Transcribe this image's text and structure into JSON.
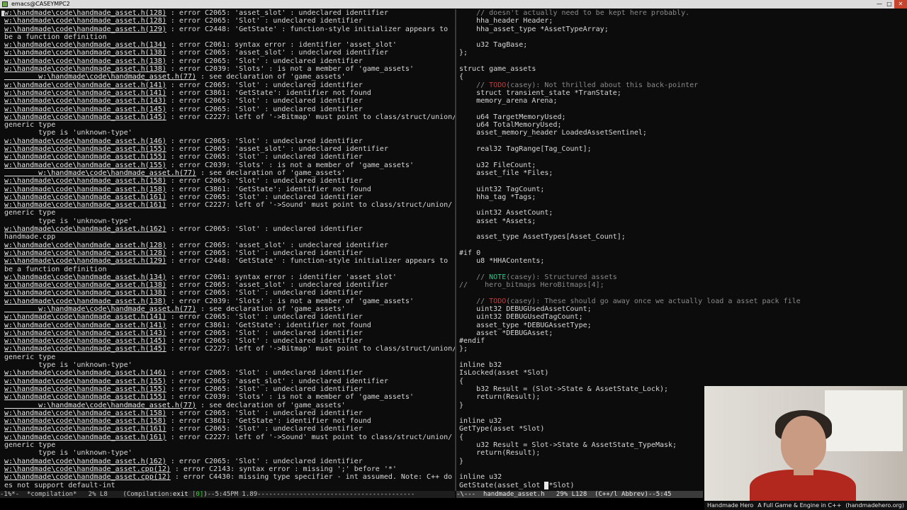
{
  "window": {
    "title": "emacs@CASEYMPC2",
    "min": "—",
    "max": "□",
    "close": "✕"
  },
  "compilation_lines": [
    "w:\\handmade\\code\\handmade_asset.h(128) : error C2065: 'asset_slot' : undeclared identifier",
    "w:\\handmade\\code\\handmade_asset.h(128) : error C2065: 'Slot' : undeclared identifier",
    "w:\\handmade\\code\\handmade_asset.h(129) : error C2448: 'GetState' : function-style initializer appears to",
    "be a function definition",
    "w:\\handmade\\code\\handmade_asset.h(134) : error C2061: syntax error : identifier 'asset_slot'",
    "w:\\handmade\\code\\handmade_asset.h(138) : error C2065: 'asset_slot' : undeclared identifier",
    "w:\\handmade\\code\\handmade_asset.h(138) : error C2065: 'Slot' : undeclared identifier",
    "w:\\handmade\\code\\handmade_asset.h(138) : error C2039: 'Slots' : is not a member of 'game_assets'",
    "        w:\\handmade\\code\\handmade_asset.h(77) : see declaration of 'game_assets'",
    "w:\\handmade\\code\\handmade_asset.h(141) : error C2065: 'Slot' : undeclared identifier",
    "w:\\handmade\\code\\handmade_asset.h(141) : error C3861: 'GetState': identifier not found",
    "w:\\handmade\\code\\handmade_asset.h(143) : error C2065: 'Slot' : undeclared identifier",
    "w:\\handmade\\code\\handmade_asset.h(145) : error C2065: 'Slot' : undeclared identifier",
    "w:\\handmade\\code\\handmade_asset.h(145) : error C2227: left of '->Bitmap' must point to class/struct/union/",
    "generic type",
    "        type is 'unknown-type'",
    "w:\\handmade\\code\\handmade_asset.h(146) : error C2065: 'Slot' : undeclared identifier",
    "w:\\handmade\\code\\handmade_asset.h(155) : error C2065: 'asset_slot' : undeclared identifier",
    "w:\\handmade\\code\\handmade_asset.h(155) : error C2065: 'Slot' : undeclared identifier",
    "w:\\handmade\\code\\handmade_asset.h(155) : error C2039: 'Slots' : is not a member of 'game_assets'",
    "        w:\\handmade\\code\\handmade_asset.h(77) : see declaration of 'game_assets'",
    "w:\\handmade\\code\\handmade_asset.h(158) : error C2065: 'Slot' : undeclared identifier",
    "w:\\handmade\\code\\handmade_asset.h(158) : error C3861: 'GetState': identifier not found",
    "w:\\handmade\\code\\handmade_asset.h(161) : error C2065: 'Slot' : undeclared identifier",
    "w:\\handmade\\code\\handmade_asset.h(161) : error C2227: left of '->Sound' must point to class/struct/union/",
    "generic type",
    "        type is 'unknown-type'",
    "w:\\handmade\\code\\handmade_asset.h(162) : error C2065: 'Slot' : undeclared identifier",
    "handmade.cpp",
    "w:\\handmade\\code\\handmade_asset.h(128) : error C2065: 'asset_slot' : undeclared identifier",
    "w:\\handmade\\code\\handmade_asset.h(128) : error C2065: 'Slot' : undeclared identifier",
    "w:\\handmade\\code\\handmade_asset.h(129) : error C2448: 'GetState' : function-style initializer appears to",
    "be a function definition",
    "w:\\handmade\\code\\handmade_asset.h(134) : error C2061: syntax error : identifier 'asset_slot'",
    "w:\\handmade\\code\\handmade_asset.h(138) : error C2065: 'asset_slot' : undeclared identifier",
    "w:\\handmade\\code\\handmade_asset.h(138) : error C2065: 'Slot' : undeclared identifier",
    "w:\\handmade\\code\\handmade_asset.h(138) : error C2039: 'Slots' : is not a member of 'game_assets'",
    "        w:\\handmade\\code\\handmade_asset.h(77) : see declaration of 'game_assets'",
    "w:\\handmade\\code\\handmade_asset.h(141) : error C2065: 'Slot' : undeclared identifier",
    "w:\\handmade\\code\\handmade_asset.h(141) : error C3861: 'GetState': identifier not found",
    "w:\\handmade\\code\\handmade_asset.h(143) : error C2065: 'Slot' : undeclared identifier",
    "w:\\handmade\\code\\handmade_asset.h(145) : error C2065: 'Slot' : undeclared identifier",
    "w:\\handmade\\code\\handmade_asset.h(145) : error C2227: left of '->Bitmap' must point to class/struct/union/",
    "generic type",
    "        type is 'unknown-type'",
    "w:\\handmade\\code\\handmade_asset.h(146) : error C2065: 'Slot' : undeclared identifier",
    "w:\\handmade\\code\\handmade_asset.h(155) : error C2065: 'asset_slot' : undeclared identifier",
    "w:\\handmade\\code\\handmade_asset.h(155) : error C2065: 'Slot' : undeclared identifier",
    "w:\\handmade\\code\\handmade_asset.h(155) : error C2039: 'Slots' : is not a member of 'game_assets'",
    "        w:\\handmade\\code\\handmade_asset.h(77) : see declaration of 'game_assets'",
    "w:\\handmade\\code\\handmade_asset.h(158) : error C2065: 'Slot' : undeclared identifier",
    "w:\\handmade\\code\\handmade_asset.h(158) : error C3861: 'GetState': identifier not found",
    "w:\\handmade\\code\\handmade_asset.h(161) : error C2065: 'Slot' : undeclared identifier",
    "w:\\handmade\\code\\handmade_asset.h(161) : error C2227: left of '->Sound' must point to class/struct/union/",
    "generic type",
    "        type is 'unknown-type'",
    "w:\\handmade\\code\\handmade_asset.h(162) : error C2065: 'Slot' : undeclared identifier",
    "w:\\handmade\\code\\handmade_asset.cpp(12) : error C2143: syntax error : missing ';' before '*'",
    "w:\\handmade\\code\\handmade_asset.cpp(12) : error C4430: missing type specifier - int assumed. Note: C++ do",
    "es not support default-int"
  ],
  "code_lines": [
    "    // doesn't actually need to be kept here probably.",
    "    hha_header Header;",
    "    hha_asset_type *AssetTypeArray;",
    "",
    "    u32 TagBase;",
    "};",
    "",
    "struct game_assets",
    "{",
    "    // TODO(casey): Not thrilled about this back-pointer",
    "    struct transient_state *TranState;",
    "    memory_arena Arena;",
    "",
    "    u64 TargetMemoryUsed;",
    "    u64 TotalMemoryUsed;",
    "    asset_memory_header LoadedAssetSentinel;",
    "",
    "    real32 TagRange[Tag_Count];",
    "",
    "    u32 FileCount;",
    "    asset_file *Files;",
    "",
    "    uint32 TagCount;",
    "    hha_tag *Tags;",
    "",
    "    uint32 AssetCount;",
    "    asset *Assets;",
    "",
    "    asset_type AssetTypes[Asset_Count];",
    "",
    "#if 0",
    "    u8 *HHAContents;",
    "",
    "    // NOTE(casey): Structured assets",
    "//    hero_bitmaps HeroBitmaps[4];",
    "",
    "    // TODO(casey): These should go away once we actually load a asset pack file",
    "    uint32 DEBUGUsedAssetCount;",
    "    uint32 DEBUGUsedTagCount;",
    "    asset_type *DEBUGAssetType;",
    "    asset *DEBUGAsset;",
    "#endif",
    "};",
    "",
    "inline b32",
    "IsLocked(asset *Slot)",
    "{",
    "    b32 Result = (Slot->State & AssetState_Lock);",
    "    return(Result);",
    "}",
    "",
    "inline u32",
    "GetType(asset *Slot)",
    "{",
    "    u32 Result = Slot->State & AssetState_TypeMask;",
    "    return(Result);",
    "}",
    "",
    "inline u32",
    "GetState(asset_slot *Slot)"
  ],
  "modeline_left": {
    "prefix": "-1%*-  ",
    "buffer": "*compilation*",
    "pos": "   2% L8    ",
    "mode_open": "(Compilation:",
    "exit": "exit",
    "exit_code": "[0]",
    "mode_close": ")--5:45PM 1.89-----------------------------------------"
  },
  "modeline_right": {
    "prefix": "-\\---  ",
    "buffer": "handmade_asset.h",
    "pos": "   29% L128  ",
    "mode": "(C++/l Abbrev)--5:45"
  },
  "stream_caption": {
    "left": "Handmade Hero",
    "middle": "A Full Game & Engine in C++",
    "right": "(handmadehero.org)"
  }
}
